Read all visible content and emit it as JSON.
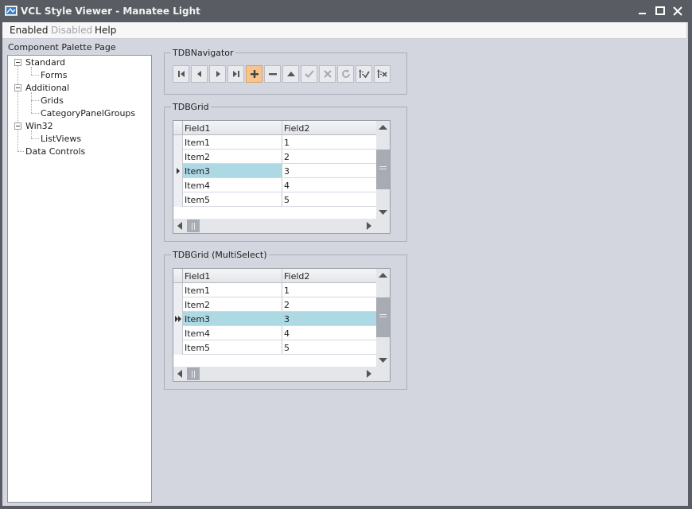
{
  "window": {
    "title": "VCL Style Viewer - Manatee Light"
  },
  "menu": {
    "items": [
      {
        "label": "Enabled",
        "disabled": false
      },
      {
        "label": "Disabled",
        "disabled": true
      },
      {
        "label": "Help",
        "disabled": false
      }
    ]
  },
  "palette": {
    "label": "Component Palette Page",
    "tree": [
      {
        "label": "Standard",
        "children": [
          "Forms"
        ]
      },
      {
        "label": "Additional",
        "children": [
          "Grids",
          "CategoryPanelGroups"
        ]
      },
      {
        "label": "Win32",
        "children": [
          "ListViews"
        ]
      },
      {
        "label": "Data Controls",
        "children": []
      }
    ]
  },
  "navigator": {
    "title": "TDBNavigator",
    "buttons": [
      {
        "name": "first",
        "icon": "first-icon"
      },
      {
        "name": "prior",
        "icon": "prior-icon"
      },
      {
        "name": "next",
        "icon": "next-icon"
      },
      {
        "name": "last",
        "icon": "last-icon"
      },
      {
        "name": "insert",
        "icon": "plus-icon",
        "active": true
      },
      {
        "name": "delete",
        "icon": "minus-icon"
      },
      {
        "name": "edit",
        "icon": "edit-up-icon"
      },
      {
        "name": "post",
        "icon": "check-icon"
      },
      {
        "name": "cancel",
        "icon": "cancel-icon"
      },
      {
        "name": "refresh",
        "icon": "refresh-icon"
      },
      {
        "name": "apply-updates",
        "icon": "apply-updates-icon"
      },
      {
        "name": "cancel-updates",
        "icon": "cancel-updates-icon"
      }
    ]
  },
  "grid1": {
    "title": "TDBGrid",
    "columns": [
      "Field1",
      "Field2"
    ],
    "rows": [
      [
        "Item1",
        "1"
      ],
      [
        "Item2",
        "2"
      ],
      [
        "Item3",
        "3"
      ],
      [
        "Item4",
        "4"
      ],
      [
        "Item5",
        "5"
      ]
    ],
    "selected_row": 2
  },
  "grid2": {
    "title": "TDBGrid (MultiSelect)",
    "columns": [
      "Field1",
      "Field2"
    ],
    "rows": [
      [
        "Item1",
        "1"
      ],
      [
        "Item2",
        "2"
      ],
      [
        "Item3",
        "3"
      ],
      [
        "Item4",
        "4"
      ],
      [
        "Item5",
        "5"
      ]
    ],
    "selected_row": 2
  },
  "colors": {
    "titlebar": "#595c63",
    "selection": "#acd9e4",
    "active_button": "#f6c58f"
  }
}
